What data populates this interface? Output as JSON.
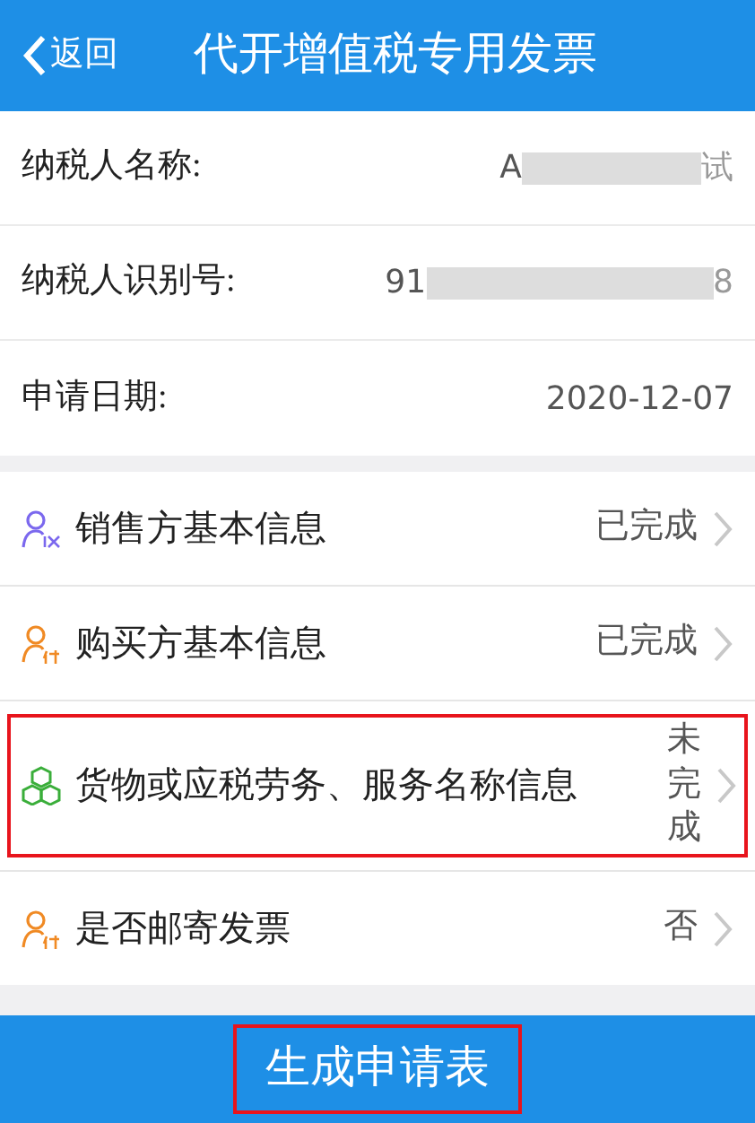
{
  "header": {
    "back": "返回",
    "title": "代开增值税专用发票"
  },
  "fields": [
    {
      "label": "纳税人名称:",
      "value_start": "A",
      "redacted": true,
      "value_end": "试"
    },
    {
      "label": "纳税人识别号:",
      "value_start": "91",
      "redacted": true,
      "value_end": "8"
    },
    {
      "label": "申请日期:",
      "value_start": "2020-12-07"
    }
  ],
  "sections": [
    {
      "kind": "seller",
      "label": "销售方基本信息",
      "status": "已完成",
      "vertical": false,
      "highlighted": false
    },
    {
      "kind": "buyer",
      "label": "购买方基本信息",
      "status": "已完成",
      "vertical": false,
      "highlighted": false
    },
    {
      "kind": "goods",
      "label": "货物或应税劳务、服务名称信息",
      "status": "未完成",
      "vertical": true,
      "highlighted": true
    },
    {
      "kind": "buyer",
      "label": "是否邮寄发票",
      "status": "否",
      "vertical": false,
      "highlighted": false
    }
  ],
  "footer": {
    "button": "生成申请表",
    "highlighted": true
  }
}
